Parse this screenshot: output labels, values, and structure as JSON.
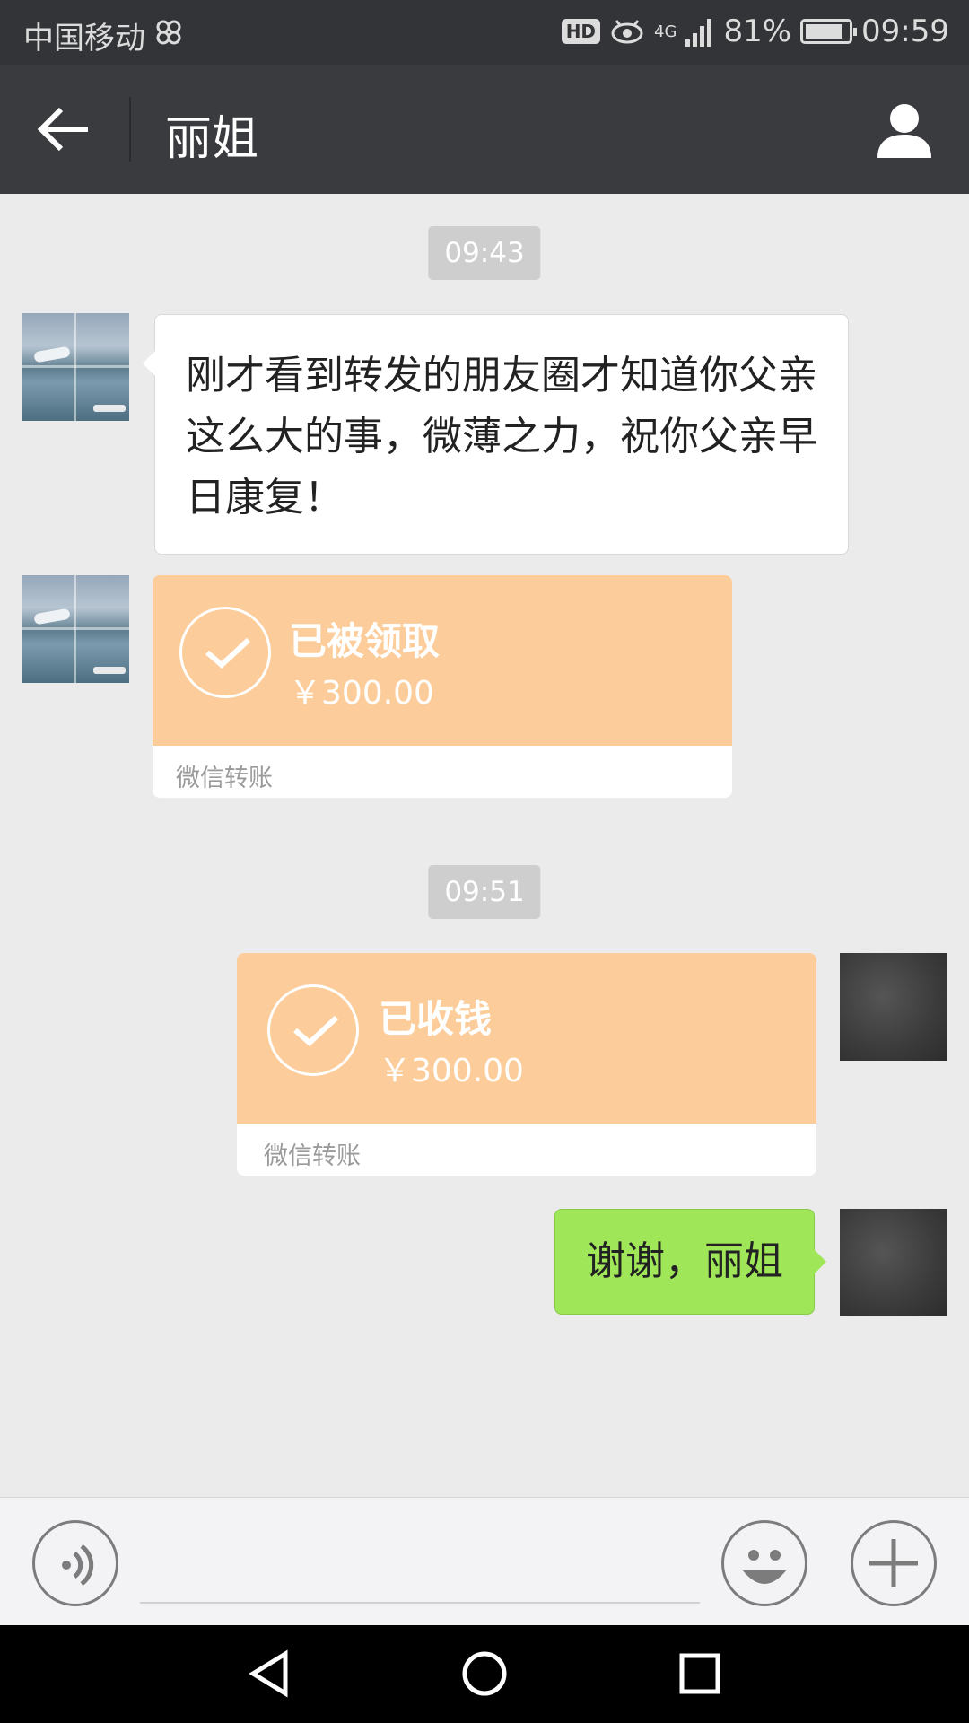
{
  "status_bar": {
    "carrier": "中国移动",
    "network": "4G",
    "hd": "HD",
    "battery": "81%",
    "time": "09:59"
  },
  "header": {
    "title": "丽姐"
  },
  "messages": [
    {
      "type": "time",
      "text": "09:43"
    },
    {
      "type": "text",
      "side": "left",
      "text": "刚才看到转发的朋友圈才知道你父亲这么大的事，微薄之力，祝你父亲早日康复！"
    },
    {
      "type": "transfer",
      "side": "left",
      "status": "已被领取",
      "amount": "￥300.00",
      "label": "微信转账"
    },
    {
      "type": "time",
      "text": "09:51"
    },
    {
      "type": "transfer",
      "side": "right",
      "status": "已收钱",
      "amount": "￥300.00",
      "label": "微信转账"
    },
    {
      "type": "text",
      "side": "right",
      "text": "谢谢，丽姐"
    }
  ],
  "input": {
    "value": "",
    "placeholder": ""
  },
  "colors": {
    "header_bg": "#3a3b3f",
    "chat_bg": "#ebebeb",
    "transfer_orange": "#fccd9a",
    "my_bubble": "#9fe658"
  }
}
